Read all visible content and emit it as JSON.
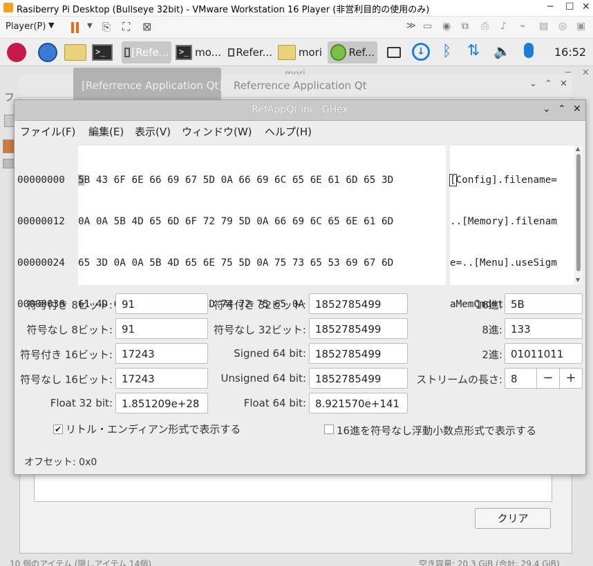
{
  "vm": {
    "title": "Rasiberry Pi Desktop (Bullseye 32bit) - VMware Workstation 16 Player (非営利目的の使用のみ)",
    "player_menu": "Player(P)",
    "min_icon": "─",
    "max_icon": "☐",
    "close_icon": "✕"
  },
  "panel": {
    "tasks": [
      "[Refe...",
      "mo...",
      "Refer...",
      "mori",
      "Ref..."
    ],
    "time": "16:52"
  },
  "bg": {
    "mori_title": "mori",
    "qt_tab_active": "[Referrence Application Qt]",
    "qt_tab": "Referrence Application Qt",
    "clear_label": "クリア",
    "status_left": "10 個のアイテム (隠しアイテム 14個)",
    "status_right": "空き容量: 20.3 GiB (合計: 29.4 GiB)"
  },
  "ghex": {
    "title": "RefAppQt.ini - GHex",
    "menu": [
      "ファイル(F)",
      "編集(E)",
      "表示(V)",
      "ウィンドウ(W)",
      "ヘルプ(H)"
    ],
    "offsets": [
      "00000000",
      "00000012",
      "00000024",
      "00000036"
    ],
    "hex_first_char": "5",
    "hex_rows": [
      "B 43 6F 6E 66 69 67 5D 0A 66 69 6C 65 6E 61 6D 65 3D",
      "0A 0A 5B 4D 65 6D 6F 72 79 5D 0A 66 69 6C 65 6E 61 6D",
      "65 3D 0A 0A 5B 4D 65 6E 75 5D 0A 75 73 65 53 69 67 6D",
      "61 4D 65 6D 43 6D 64 3D 74 72 75 65 0A"
    ],
    "ascii_first_char": "[",
    "ascii_rows": [
      "Config].filename=",
      "..[Memory].filenam",
      "e=..[Menu].useSigm",
      "aMemCmd=true."
    ],
    "fields": {
      "s8_label": "符号付き 8ビット:",
      "s8": "91",
      "u8_label": "符号なし 8ビット:",
      "u8": "91",
      "s16_label": "符号付き 16ビット:",
      "s16": "17243",
      "u16_label": "符号なし 16ビット:",
      "u16": "17243",
      "f32_label": "Float 32 bit:",
      "f32": "1.851209e+28",
      "s32_label": "符号付き 32ビット:",
      "s32": "1852785499",
      "u32_label": "符号なし 32ビット:",
      "u32": "1852785499",
      "s64_label": "Signed 64 bit:",
      "s64": "1852785499",
      "u64_label": "Unsigned 64 bit:",
      "u64": "1852785499",
      "f64_label": "Float 64 bit:",
      "f64": "8.921570e+141",
      "hex_label": "16進:",
      "hex": "5B",
      "oct_label": "8進:",
      "oct": "133",
      "bin_label": "2進:",
      "bin": "01011011",
      "stream_label": "ストリームの長さ:",
      "stream": "8"
    },
    "little_endian_label": "リトル・エンディアン形式で表示する",
    "little_endian_checked": true,
    "unsigned_float_label": "16進を符号なし浮動小数点形式で表示する",
    "unsigned_float_checked": false,
    "offset_status": "オフセット: 0x0"
  }
}
